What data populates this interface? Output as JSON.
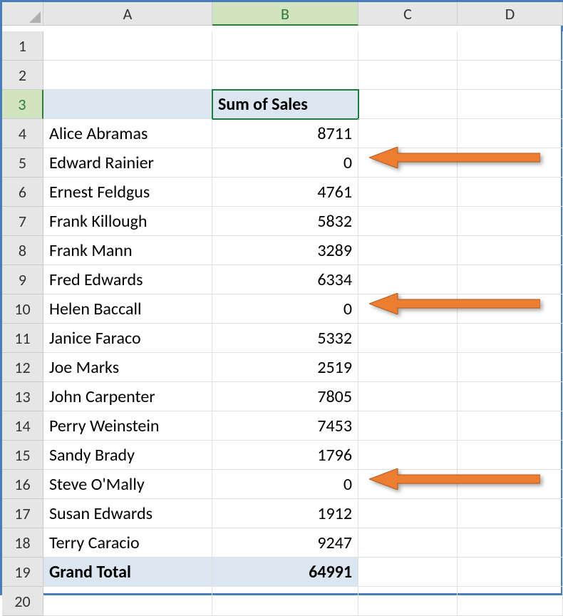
{
  "columns": [
    "A",
    "B",
    "C",
    "D"
  ],
  "selected_column_index": 1,
  "selected_row": 3,
  "active_cell": "B3",
  "rows": [
    {
      "n": 1,
      "a": "",
      "b": ""
    },
    {
      "n": 2,
      "a": "",
      "b": ""
    },
    {
      "n": 3,
      "a": "",
      "b": "Sum of Sales",
      "header": true
    },
    {
      "n": 4,
      "a": "Alice Abramas",
      "b": "8711"
    },
    {
      "n": 5,
      "a": "Edward Rainier",
      "b": "0",
      "flag": true
    },
    {
      "n": 6,
      "a": "Ernest Feldgus",
      "b": "4761"
    },
    {
      "n": 7,
      "a": "Frank Killough",
      "b": "5832"
    },
    {
      "n": 8,
      "a": "Frank Mann",
      "b": "3289"
    },
    {
      "n": 9,
      "a": "Fred Edwards",
      "b": "6334"
    },
    {
      "n": 10,
      "a": "Helen Baccall",
      "b": "0",
      "flag": true
    },
    {
      "n": 11,
      "a": "Janice Faraco",
      "b": "5332"
    },
    {
      "n": 12,
      "a": "Joe Marks",
      "b": "2519"
    },
    {
      "n": 13,
      "a": "John Carpenter",
      "b": "7805"
    },
    {
      "n": 14,
      "a": "Perry Weinstein",
      "b": "7453"
    },
    {
      "n": 15,
      "a": "Sandy Brady",
      "b": "1796"
    },
    {
      "n": 16,
      "a": "Steve O'Mally",
      "b": "0",
      "flag": true
    },
    {
      "n": 17,
      "a": "Susan Edwards",
      "b": "1912"
    },
    {
      "n": 18,
      "a": "Terry Caracio",
      "b": "9247"
    },
    {
      "n": 19,
      "a": "Grand Total",
      "b": "64991",
      "total": true
    },
    {
      "n": 20,
      "a": "",
      "b": ""
    }
  ],
  "arrow_color": "#ed7d31"
}
